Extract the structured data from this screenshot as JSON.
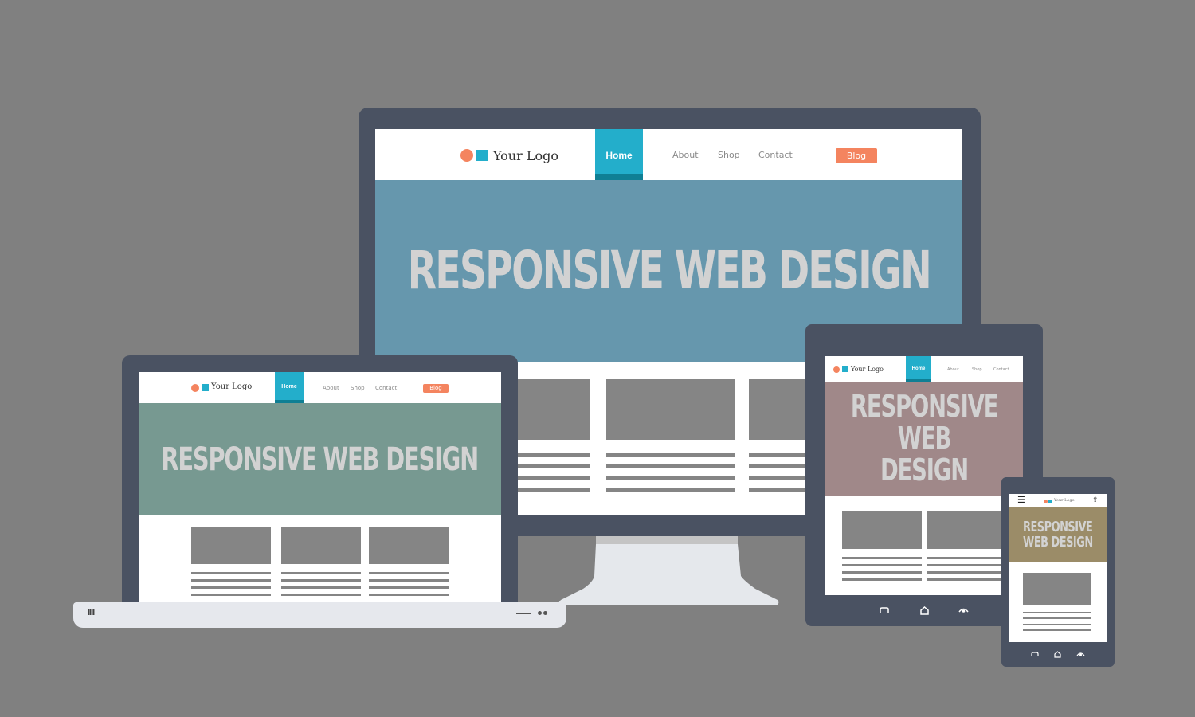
{
  "scene": "Responsive web design device mockup",
  "colors": {
    "background": "#808080",
    "device_frame": "#4a5262",
    "accent_teal": "#23aecb",
    "accent_orange": "#f4845f",
    "monitor_hero": "#6697ad",
    "laptop_hero": "#779991",
    "tablet_hero": "#a08889",
    "phone_hero": "#9b8c68"
  },
  "site": {
    "logo_text": "Your Logo",
    "nav": {
      "home": "Home",
      "about": "About",
      "shop": "Shop",
      "contact": "Contact",
      "blog": "Blog"
    },
    "hero_title": "RESPONSIVE WEB DESIGN",
    "hero_title_line1": "RESPONSIVE",
    "hero_title_line2": "WEB DESIGN"
  },
  "devices": {
    "monitor": {
      "label": "desktop-monitor"
    },
    "laptop": {
      "label": "laptop",
      "keyboard_glyph": "IIII"
    },
    "tablet": {
      "label": "tablet",
      "buttons": [
        "back-icon",
        "home-icon",
        "recent-icon"
      ]
    },
    "phone": {
      "label": "phone",
      "menu_glyph": "☰",
      "share_glyph": "⇪",
      "buttons": [
        "back-icon",
        "home-icon",
        "recent-icon"
      ]
    }
  }
}
